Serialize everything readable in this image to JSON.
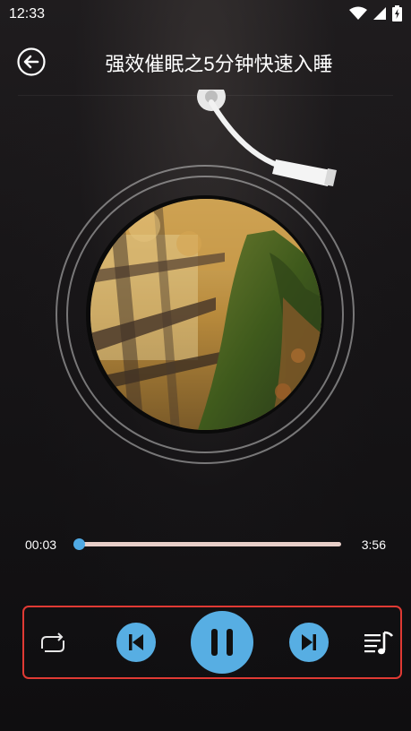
{
  "status_bar": {
    "time": "12:33",
    "icons": [
      "wifi-icon",
      "cellular-signal-icon",
      "battery-charging-icon"
    ]
  },
  "header": {
    "title": "强效催眠之5分钟快速入睡",
    "back_icon": "back-arrow-icon"
  },
  "player": {
    "current_time": "00:03",
    "total_time": "3:56",
    "progress_fraction": 0.013,
    "state": "playing",
    "cover_image": "autumn forest tree trunks with moss"
  },
  "controls": {
    "loop_icon": "repeat-icon",
    "previous_icon": "skip-previous-icon",
    "play_pause_icon": "pause-icon",
    "next_icon": "skip-next-icon",
    "playlist_icon": "playlist-music-icon"
  },
  "colors": {
    "accent": "#57aee3",
    "highlight_border": "#e03a34",
    "track": "#e8cfc9",
    "background": "#151316"
  }
}
